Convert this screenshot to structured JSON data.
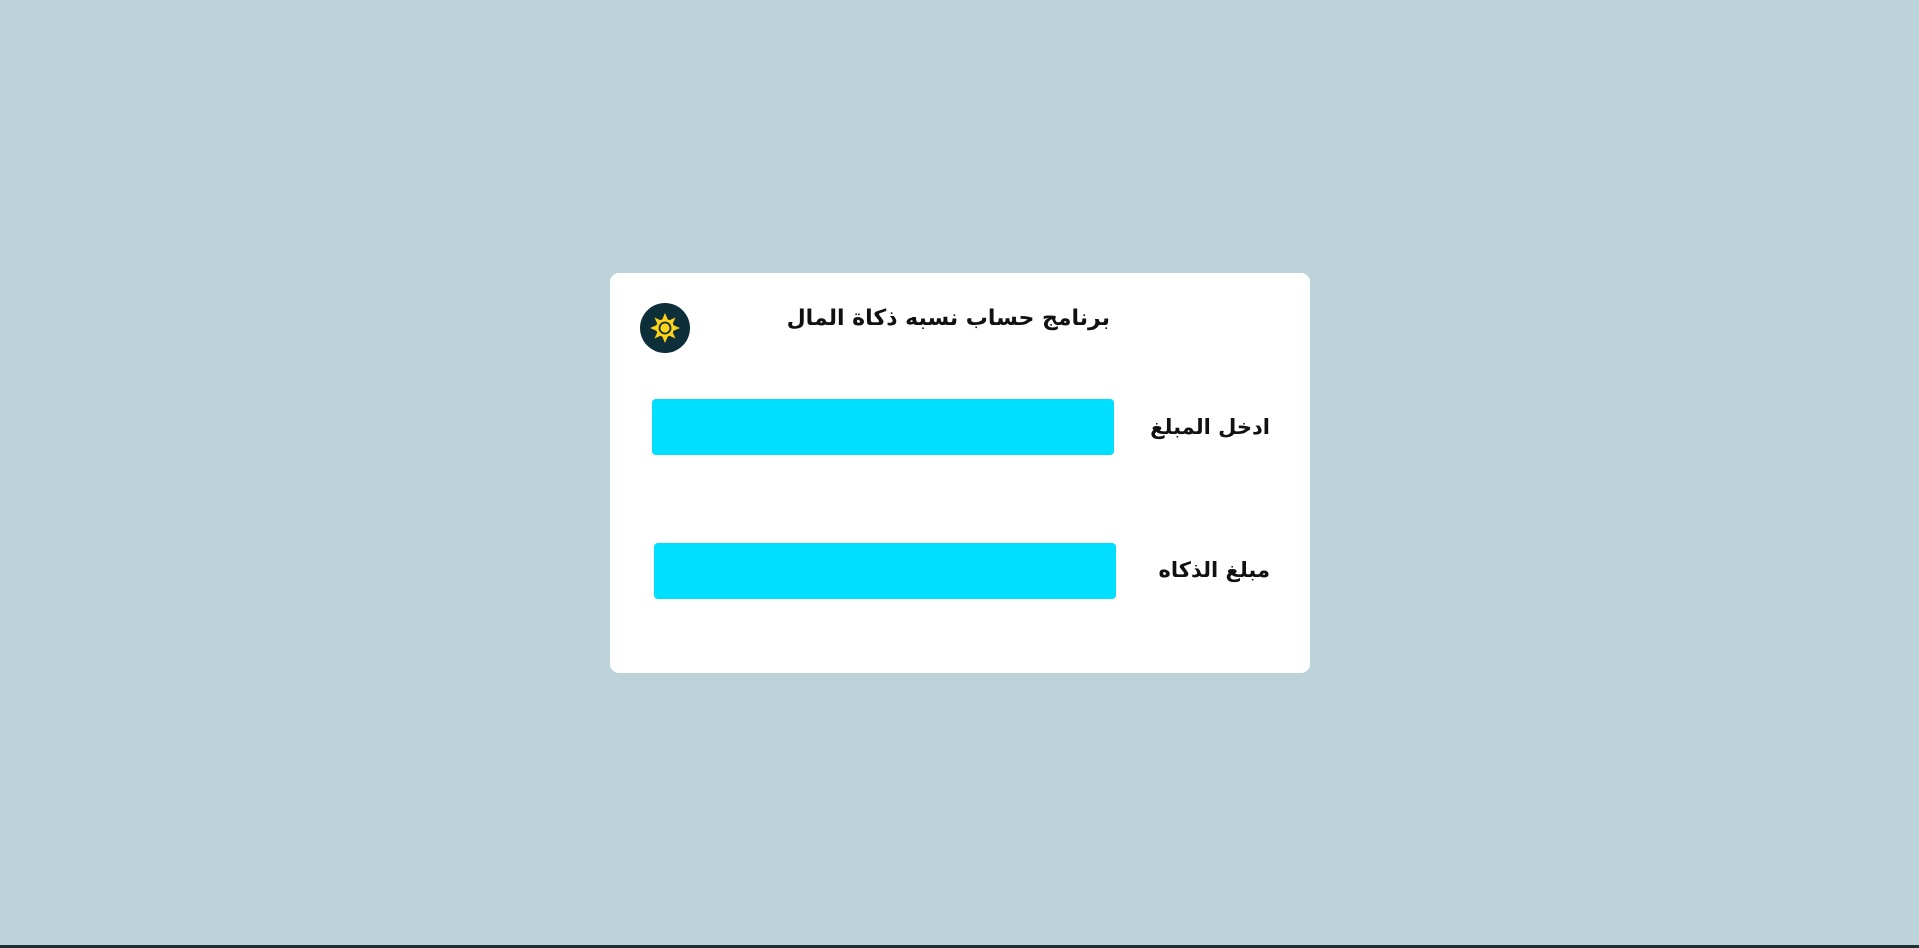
{
  "app": {
    "title": "برنامج حساب نسبه ذكاة المال"
  },
  "theme_toggle": {
    "icon": "sun-icon",
    "background": "#0d2f3a",
    "icon_color": "#ffd21a"
  },
  "form": {
    "amount_label": "ادخل المبلغ",
    "amount_value": "",
    "zakat_label": "مبلغ الذكاه",
    "zakat_value": ""
  },
  "colors": {
    "page_background": "#bbd3d9",
    "card_background": "#ffffff",
    "field_background": "#00dfff",
    "caret": "#3ee2ff"
  }
}
